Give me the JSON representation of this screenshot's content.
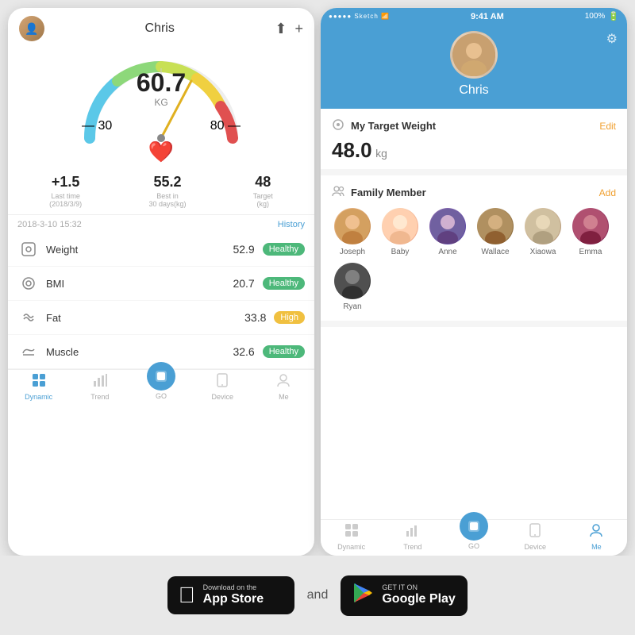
{
  "leftPhone": {
    "userName": "Chris",
    "weight": "60.7",
    "weightUnit": "KG",
    "gaugeMin": "— 30",
    "gaugeMax": "80 —",
    "stats": [
      {
        "value": "+1.5",
        "label": "Last time\n(2018/3/9)"
      },
      {
        "value": "55.2",
        "label": "Best in\n30 days(kg)"
      },
      {
        "value": "48",
        "label": "Target\n(kg)"
      }
    ],
    "historyDate": "2018-3-10 15:32",
    "historyLabel": "History",
    "metrics": [
      {
        "name": "Weight",
        "value": "52.9",
        "badge": "Healthy",
        "badgeType": "healthy",
        "icon": "⊡"
      },
      {
        "name": "BMI",
        "value": "20.7",
        "badge": "Healthy",
        "badgeType": "healthy",
        "icon": "⊙"
      },
      {
        "name": "Fat",
        "value": "33.8",
        "badge": "High",
        "badgeType": "high",
        "icon": "☆"
      },
      {
        "name": "Muscle",
        "value": "32.6",
        "badge": "Healthy",
        "badgeType": "healthy",
        "icon": "⚡"
      }
    ],
    "nav": [
      {
        "label": "Dynamic",
        "active": true,
        "icon": "⊞"
      },
      {
        "label": "Trend",
        "active": false,
        "icon": "📊"
      },
      {
        "label": "GO",
        "active": false,
        "icon": "▶",
        "isGo": true
      },
      {
        "label": "Device",
        "active": false,
        "icon": "📱"
      },
      {
        "label": "Me",
        "active": false,
        "icon": "☺"
      }
    ]
  },
  "rightPhone": {
    "statusBar": {
      "signal": "●●●●●",
      "network": "Sketch",
      "time": "9:41 AM",
      "battery": "100%"
    },
    "userName": "Chris",
    "settingsIcon": "⚙",
    "targetWeight": {
      "label": "My Target Weight",
      "editLabel": "Edit",
      "value": "48.0",
      "unit": "kg"
    },
    "familyMember": {
      "label": "Family Member",
      "addLabel": "Add",
      "members": [
        {
          "name": "Joseph",
          "avatarClass": "av-joseph",
          "emoji": "😄"
        },
        {
          "name": "Baby",
          "avatarClass": "av-baby",
          "emoji": "👶"
        },
        {
          "name": "Anne",
          "avatarClass": "av-anne",
          "emoji": "💆"
        },
        {
          "name": "Wallace",
          "avatarClass": "av-wallace",
          "emoji": "🧔"
        },
        {
          "name": "Xiaowa",
          "avatarClass": "av-xiaowa",
          "emoji": "🤱"
        },
        {
          "name": "Emma",
          "avatarClass": "av-emma",
          "emoji": "👩"
        },
        {
          "name": "Ryan",
          "avatarClass": "av-ryan",
          "emoji": "🧑"
        }
      ]
    },
    "nav": [
      {
        "label": "Dynamic",
        "active": false,
        "icon": "⊞"
      },
      {
        "label": "Trend",
        "active": false,
        "icon": "📊"
      },
      {
        "label": "GO",
        "active": false,
        "icon": "▶",
        "isGo": true
      },
      {
        "label": "Device",
        "active": false,
        "icon": "📱"
      },
      {
        "label": "Me",
        "active": true,
        "icon": "☺"
      }
    ]
  },
  "storeSection": {
    "appStore": {
      "sub": "Download on the",
      "name": "App Store"
    },
    "andText": "and",
    "googlePlay": {
      "sub": "GET IT ON",
      "name": "Google Play"
    }
  }
}
